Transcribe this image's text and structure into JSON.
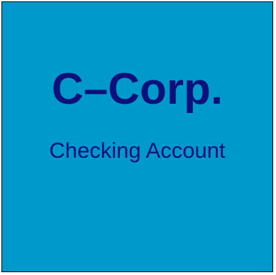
{
  "tile": {
    "title": "C–Corp.",
    "subtitle": "Checking Account"
  },
  "colors": {
    "background": "#0099cc",
    "text": "#0c107a",
    "border": "#000000"
  }
}
